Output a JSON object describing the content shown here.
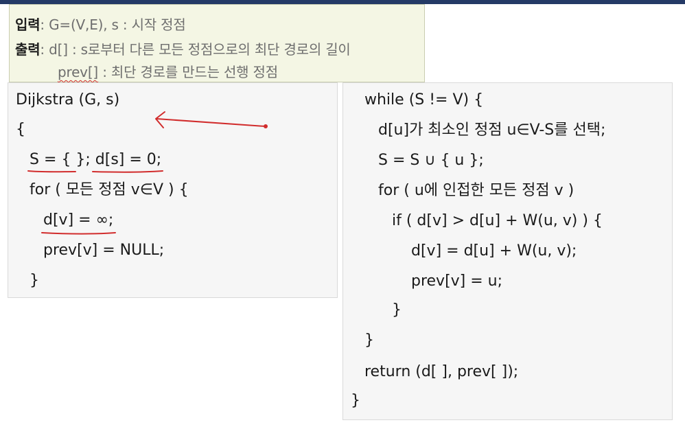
{
  "io": {
    "input_label": "입력",
    "input_text": ": G=(V,E), s : 시작 정점",
    "output_label": "출력",
    "output_text": ": d[] : s로부터 다른 모든 정점으로의 최단 경로의 길이",
    "prev_token": "prev[]",
    "prev_text": " : 최단 경로를 만드는 선행 정점"
  },
  "left_code": {
    "lines": [
      "Dijkstra (G, s)",
      "{",
      "S = { }; d[s] = 0;",
      "for ( 모든 정점 v∈V ) {",
      "d[v] = ∞;",
      "prev[v] = NULL;",
      "}"
    ]
  },
  "right_code": {
    "lines": [
      "while (S != V) {",
      "d[u]가 최소인 정점 u∈V-S를 선택;",
      "S = S ∪ { u };",
      "for ( u에 인접한 모든 정점 v )",
      "if ( d[v] > d[u] + W(u, v) ) {",
      "d[v] = d[u] + W(u, v);",
      "prev[v] = u;",
      "}",
      "}",
      "return (d[ ], prev[ ]);",
      "}"
    ]
  },
  "annotation_color": "#d12c2c"
}
